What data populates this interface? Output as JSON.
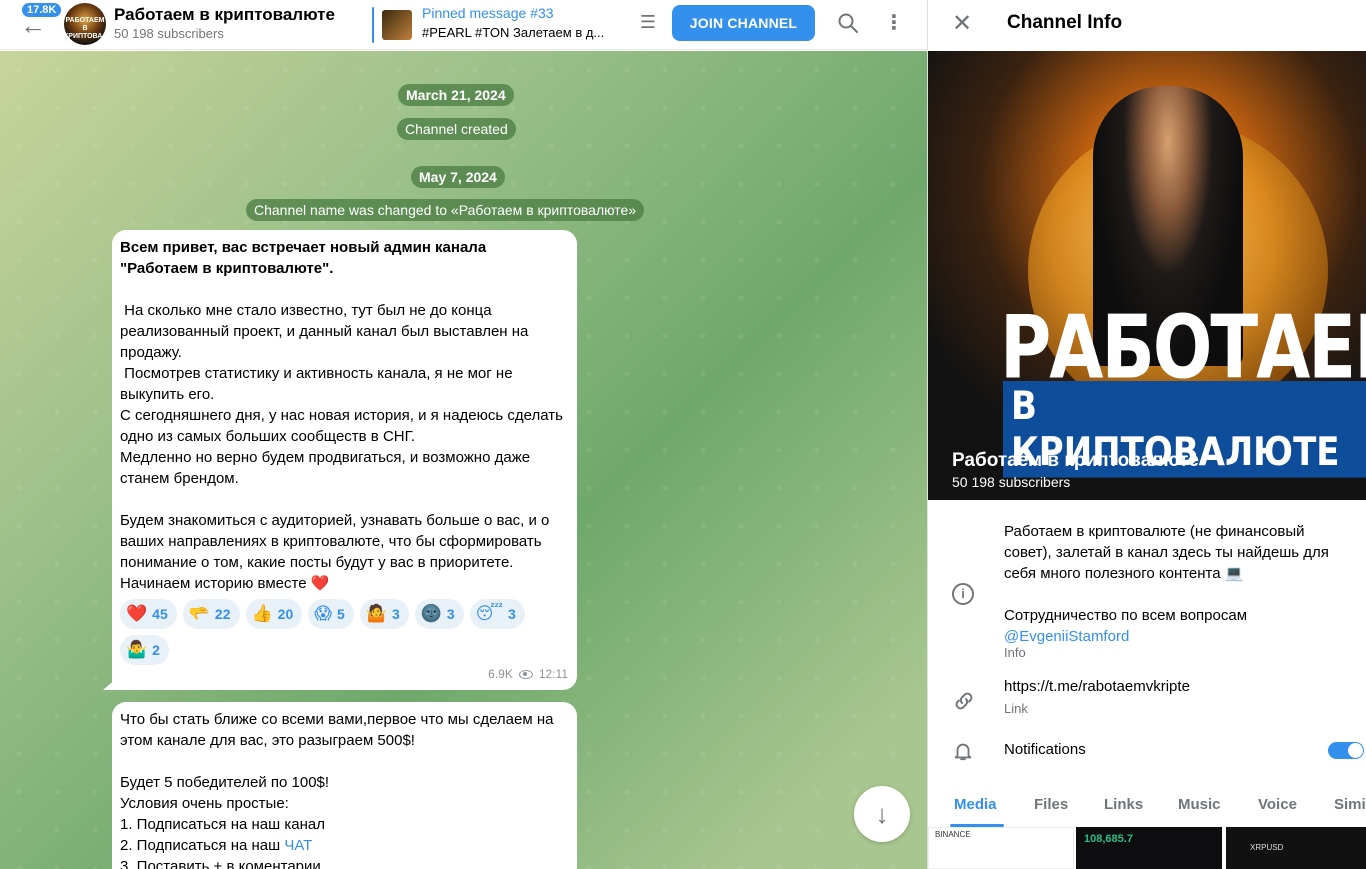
{
  "header": {
    "unread_badge": "17.8K",
    "avatar_text": "РАБОТАЕМ В КРИПТОВАЛЮТЕ",
    "title": "Работаем в криптовалюте",
    "subtitle": "50 198 subscribers",
    "pinned_title": "Pinned message #33",
    "pinned_text": "#PEARL #TON Залетаем в д...",
    "join_label": "JOIN CHANNEL"
  },
  "chat": {
    "services": [
      "March 21, 2024",
      "Channel created",
      "May 7, 2024",
      "Channel name was changed to «Работаем в криптовалюте»"
    ],
    "message1": {
      "bold": "Всем привет, вас встречает новый админ канала \"Работаем в криптовалюте\".",
      "body": "\n На сколько мне стало известно, тут был не до конца реализованный проект, и данный канал был выставлен на продажу.\n Посмотрев статистику и активность канала, я не мог не выкупить его.\nС сегодняшнего дня, у нас новая история, и я надеюсь сделать одно из самых больших сообществ в СНГ.\nМедленно но верно будем продвигаться, и возможно даже станем брендом.\n\nБудем знакомиться с аудиторией, узнавать больше о вас, и о ваших направлениях в криптовалюте, что бы сформировать понимание о том, какие посты будут у вас в приоритете.\nНачинаем историю вместе ❤️",
      "reactions": [
        {
          "emoji": "❤️",
          "count": "45"
        },
        {
          "emoji": "🫳",
          "count": "22"
        },
        {
          "emoji": "👍",
          "count": "20"
        },
        {
          "emoji": "😱",
          "count": "5"
        },
        {
          "emoji": "🤷",
          "count": "3"
        },
        {
          "emoji": "🌚",
          "count": "3"
        },
        {
          "emoji": "😴",
          "count": "3"
        },
        {
          "emoji": "🤷‍♂️",
          "count": "2"
        }
      ],
      "views": "6.9K",
      "time": "12:11"
    },
    "message2": {
      "line1": "Что бы стать ближе со всеми вами,первое что мы сделаем на этом канале для вас, это разыграем 500$!",
      "line2": "Будет 5 победителей по 100$!",
      "line3": "Условия очень простые:",
      "line4": "1. Подписаться на наш канал",
      "line5_prefix": "2. Подписаться на наш ",
      "line5_link": "ЧАТ",
      "line6": "3. Поставить + в коментарии"
    }
  },
  "panel": {
    "title": "Channel Info",
    "cover_big": "РАБОТАЕМ",
    "cover_sub": "В КРИПТОВАЛЮТЕ",
    "cover_name": "Работаем в криптовалюте",
    "cover_subs": "50 198 subscribers",
    "description": "Работаем в криптовалюте (не финансовый совет), залетай в канал здесь ты найдешь для себя много полезного контента 💻\n\nСотрудничество по всем вопросам",
    "description_link": "@EvgeniiStamford",
    "info_label": "Info",
    "link_url": "https://t.me/rabotaemvkripte",
    "link_label": "Link",
    "notifications_label": "Notifications",
    "notifications_on": true,
    "tabs": [
      "Media",
      "Files",
      "Links",
      "Music",
      "Voice",
      "Simi"
    ],
    "active_tab": "Media",
    "thumbs": {
      "t1": "BINANCE",
      "t2_price": "108,685.7",
      "t3_pair": "XRPUSD"
    }
  },
  "colors": {
    "accent": "#3390ec",
    "chat_bg": "#9cc08a",
    "service_bg": "#4a7c42"
  }
}
